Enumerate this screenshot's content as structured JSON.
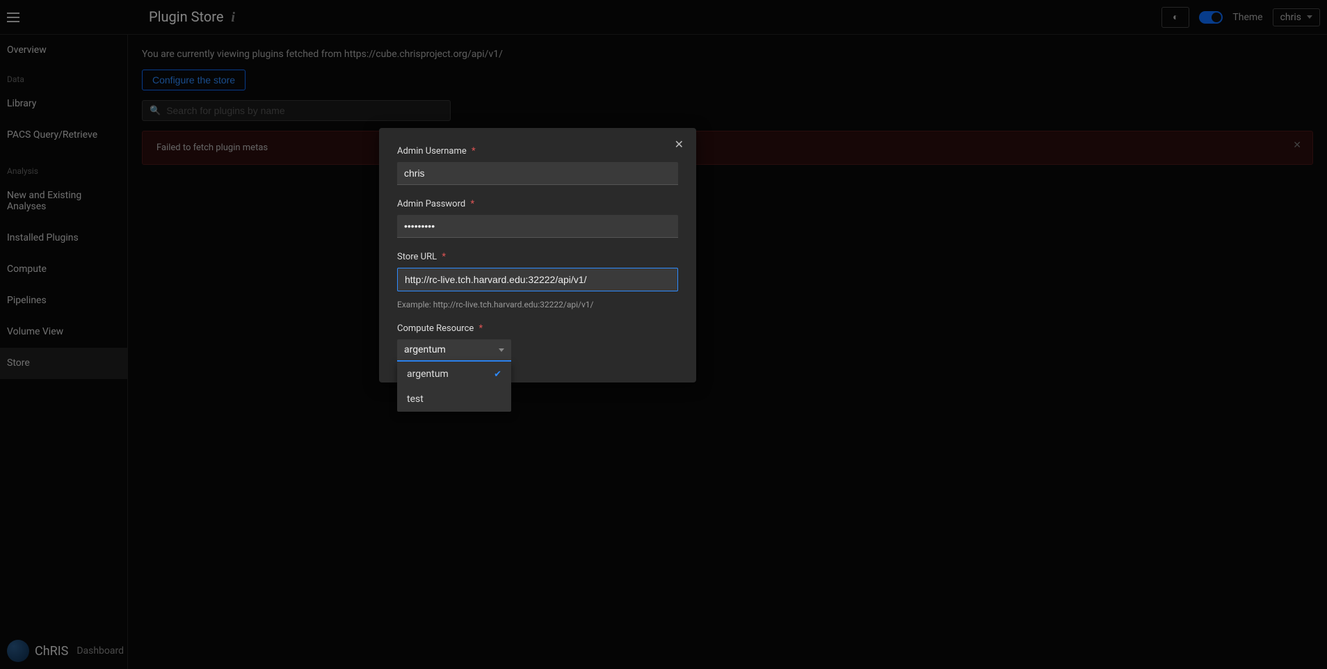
{
  "topbar": {
    "page_title": "Plugin Store",
    "theme_label": "Theme",
    "user": "chris"
  },
  "sidebar": {
    "items_data": [
      {
        "label": "Overview",
        "type": "item"
      },
      {
        "label": "Data",
        "type": "section"
      },
      {
        "label": "Library",
        "type": "item"
      },
      {
        "label": "PACS Query/Retrieve",
        "type": "item"
      },
      {
        "label": "Analysis",
        "type": "section"
      },
      {
        "label": "New and Existing Analyses",
        "type": "item"
      },
      {
        "label": "Installed Plugins",
        "type": "item"
      },
      {
        "label": "Compute",
        "type": "item"
      },
      {
        "label": "Pipelines",
        "type": "item"
      },
      {
        "label": "Volume View",
        "type": "item"
      },
      {
        "label": "Store",
        "type": "item",
        "active": true
      }
    ],
    "items": {
      "0": {
        "label": "Overview"
      },
      "1": {
        "label": "Data"
      },
      "2": {
        "label": "Library"
      },
      "3": {
        "label": "PACS Query/Retrieve"
      },
      "4": {
        "label": "Analysis"
      },
      "5": {
        "label": "New and Existing Analyses"
      },
      "6": {
        "label": "Installed Plugins"
      },
      "7": {
        "label": "Compute"
      },
      "8": {
        "label": "Pipelines"
      },
      "9": {
        "label": "Volume View"
      },
      "10": {
        "label": "Store"
      }
    },
    "footer": {
      "brand": "ChRIS",
      "sub": "Dashboard"
    }
  },
  "main": {
    "notice": "You are currently viewing plugins fetched from https://cube.chrisproject.org/api/v1/",
    "configure_button": "Configure the store",
    "search_placeholder": "Search for plugins by name",
    "error": "Failed to fetch plugin metas"
  },
  "modal": {
    "fields": {
      "username_label": "Admin Username",
      "username_value": "chris",
      "password_label": "Admin Password",
      "password_value": "•••••••••",
      "storeurl_label": "Store URL",
      "storeurl_value": "http://rc-live.tch.harvard.edu:32222/api/v1/",
      "storeurl_example": "Example: http://rc-live.tch.harvard.edu:32222/api/v1/",
      "compute_label": "Compute Resource",
      "compute_selected": "argentum"
    },
    "dropdown_options": {
      "0": "argentum",
      "1": "test"
    }
  }
}
